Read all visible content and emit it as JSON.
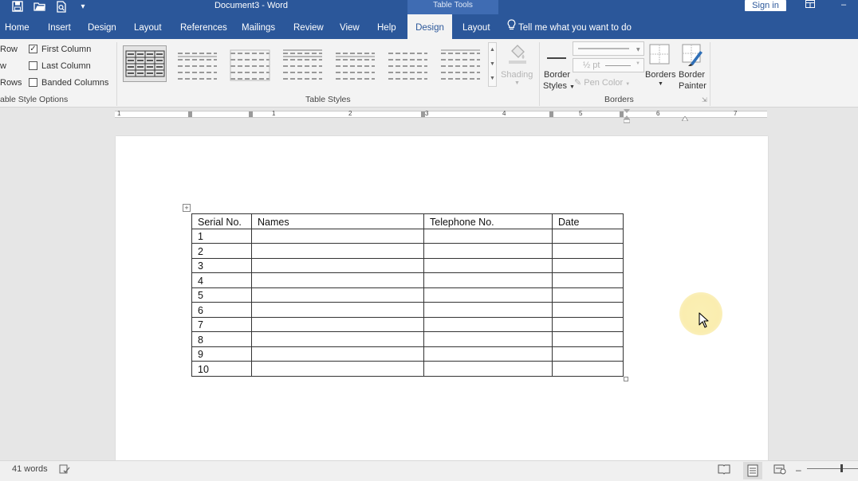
{
  "titlebar": {
    "doc_title": "Document3  -  Word",
    "context_band": "Table Tools",
    "sign_in": "Sign in",
    "qat_icons": [
      "save-icon",
      "open-icon",
      "print-preview-icon",
      "customize-qat-icon"
    ]
  },
  "tabs": [
    {
      "label": "Home",
      "active": false
    },
    {
      "label": "Insert",
      "active": false
    },
    {
      "label": "Design",
      "active": false
    },
    {
      "label": "Layout",
      "active": false
    },
    {
      "label": "References",
      "active": false
    },
    {
      "label": "Mailings",
      "active": false
    },
    {
      "label": "Review",
      "active": false
    },
    {
      "label": "View",
      "active": false
    },
    {
      "label": "Help",
      "active": false
    },
    {
      "label": "Design",
      "active": true
    },
    {
      "label": "Layout",
      "active": false
    }
  ],
  "tell_me": "Tell me what you want to do",
  "table_style_options": {
    "items": [
      {
        "label": "Row",
        "checked": null
      },
      {
        "label": "w",
        "checked": null
      },
      {
        "label": "Rows",
        "checked": null
      },
      {
        "label": "First Column",
        "checked": true
      },
      {
        "label": "Last Column",
        "checked": false
      },
      {
        "label": "Banded Columns",
        "checked": false
      }
    ],
    "group_label": "able Style Options"
  },
  "table_styles": {
    "group_label": "Table Styles",
    "shading_label": "Shading"
  },
  "borders": {
    "border_styles_line1": "Border",
    "border_styles_line2": "Styles",
    "pen_weight": "½ pt",
    "pen_color": "Pen Color",
    "borders_label": "Borders",
    "border_painter_line1": "Border",
    "border_painter_line2": "Painter",
    "group_label": "Borders"
  },
  "ruler_numbers": [
    "1",
    "1",
    "2",
    "3",
    "4",
    "5",
    "6",
    "7"
  ],
  "document_table": {
    "headers": [
      "Serial No.",
      "Names",
      "Telephone No.",
      "Date"
    ],
    "rows": [
      [
        "1",
        "",
        "",
        ""
      ],
      [
        "2",
        "",
        "",
        ""
      ],
      [
        "3",
        "",
        "",
        ""
      ],
      [
        "4",
        "",
        "",
        ""
      ],
      [
        "5",
        "",
        "",
        ""
      ],
      [
        "6",
        "",
        "",
        ""
      ],
      [
        "7",
        "",
        "",
        ""
      ],
      [
        "8",
        "",
        "",
        ""
      ],
      [
        "9",
        "",
        "",
        ""
      ],
      [
        "10",
        "",
        "",
        ""
      ]
    ]
  },
  "statusbar": {
    "word_count": "41 words"
  },
  "colors": {
    "ribbon_blue": "#2b579a",
    "context_band": "#3f6cb3",
    "ribbon_bg": "#f3f3f3"
  }
}
